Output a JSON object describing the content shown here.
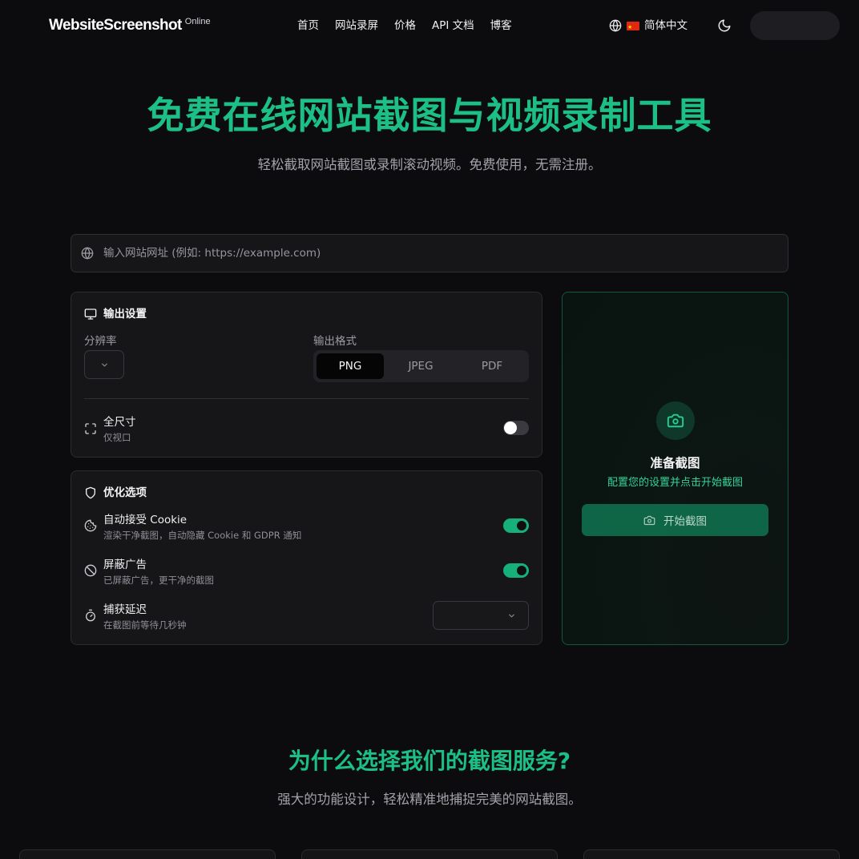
{
  "header": {
    "logo_text": "WebsiteScreenshot",
    "logo_sup": "Online",
    "nav": [
      "首页",
      "网站录屏",
      "价格",
      "API 文档",
      "博客"
    ],
    "language": "简体中文"
  },
  "hero": {
    "title": "免费在线网站截图与视频录制工具",
    "subtitle": "轻松截取网站截图或录制滚动视频。免费使用，无需注册。"
  },
  "url_input": {
    "placeholder": "输入网站网址 (例如: https://example.com)"
  },
  "output_settings": {
    "title": "输出设置",
    "resolution_label": "分辨率",
    "format_label": "输出格式",
    "formats": [
      "PNG",
      "JPEG",
      "PDF"
    ],
    "selected_format": "PNG",
    "fullsize": {
      "title": "全尺寸",
      "desc": "仅视口",
      "enabled": false
    }
  },
  "optimization": {
    "title": "优化选项",
    "cookie": {
      "title": "自动接受 Cookie",
      "desc": "渲染干净截图，自动隐藏 Cookie 和 GDPR 通知",
      "enabled": true
    },
    "ads": {
      "title": "屏蔽广告",
      "desc": "已屏蔽广告，更干净的截图",
      "enabled": true
    },
    "delay": {
      "title": "捕获延迟",
      "desc": "在截图前等待几秒钟",
      "value": ""
    }
  },
  "preview": {
    "title": "准备截图",
    "subtitle": "配置您的设置并点击开始截图",
    "button": "开始截图"
  },
  "why": {
    "title": "为什么选择我们的截图服务?",
    "subtitle": "强大的功能设计，轻松精准地捕捉完美的网站截图。"
  },
  "colors": {
    "accent": "#1cbf85",
    "toggle_on": "#16b07b",
    "button": "#0f6d4c",
    "background": "#0c0c0e"
  }
}
